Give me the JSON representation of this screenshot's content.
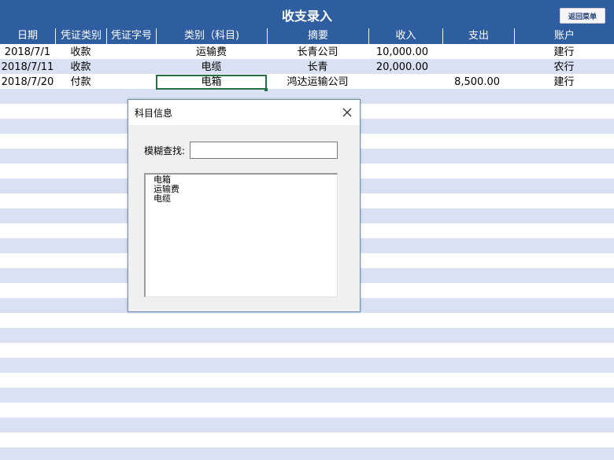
{
  "sheet": {
    "title": "收支录入",
    "return_button": "返回菜单",
    "headers": [
      "日期",
      "凭证类别",
      "凭证字号",
      "类别（科目)",
      "摘要",
      "收入",
      "支出",
      "账户"
    ],
    "rows": [
      [
        "2018/7/1",
        "收款",
        "",
        "运输费",
        "长青公司",
        "10,000.00",
        "",
        "建行"
      ],
      [
        "2018/7/11",
        "收款",
        "",
        "电缆",
        "长青",
        "20,000.00",
        "",
        "农行"
      ],
      [
        "2018/7/20",
        "付款",
        "",
        "电箱",
        "鸿达运输公司",
        "",
        "8,500.00",
        "建行"
      ]
    ]
  },
  "dialog": {
    "title": "科目信息",
    "search_label": "模糊查找:",
    "search_value": "",
    "items": [
      "电箱",
      "运输费",
      "电缆"
    ]
  },
  "colors": {
    "header_blue": "#2e5da0",
    "stripe": "#d9e1f2",
    "selection_green": "#217346"
  }
}
